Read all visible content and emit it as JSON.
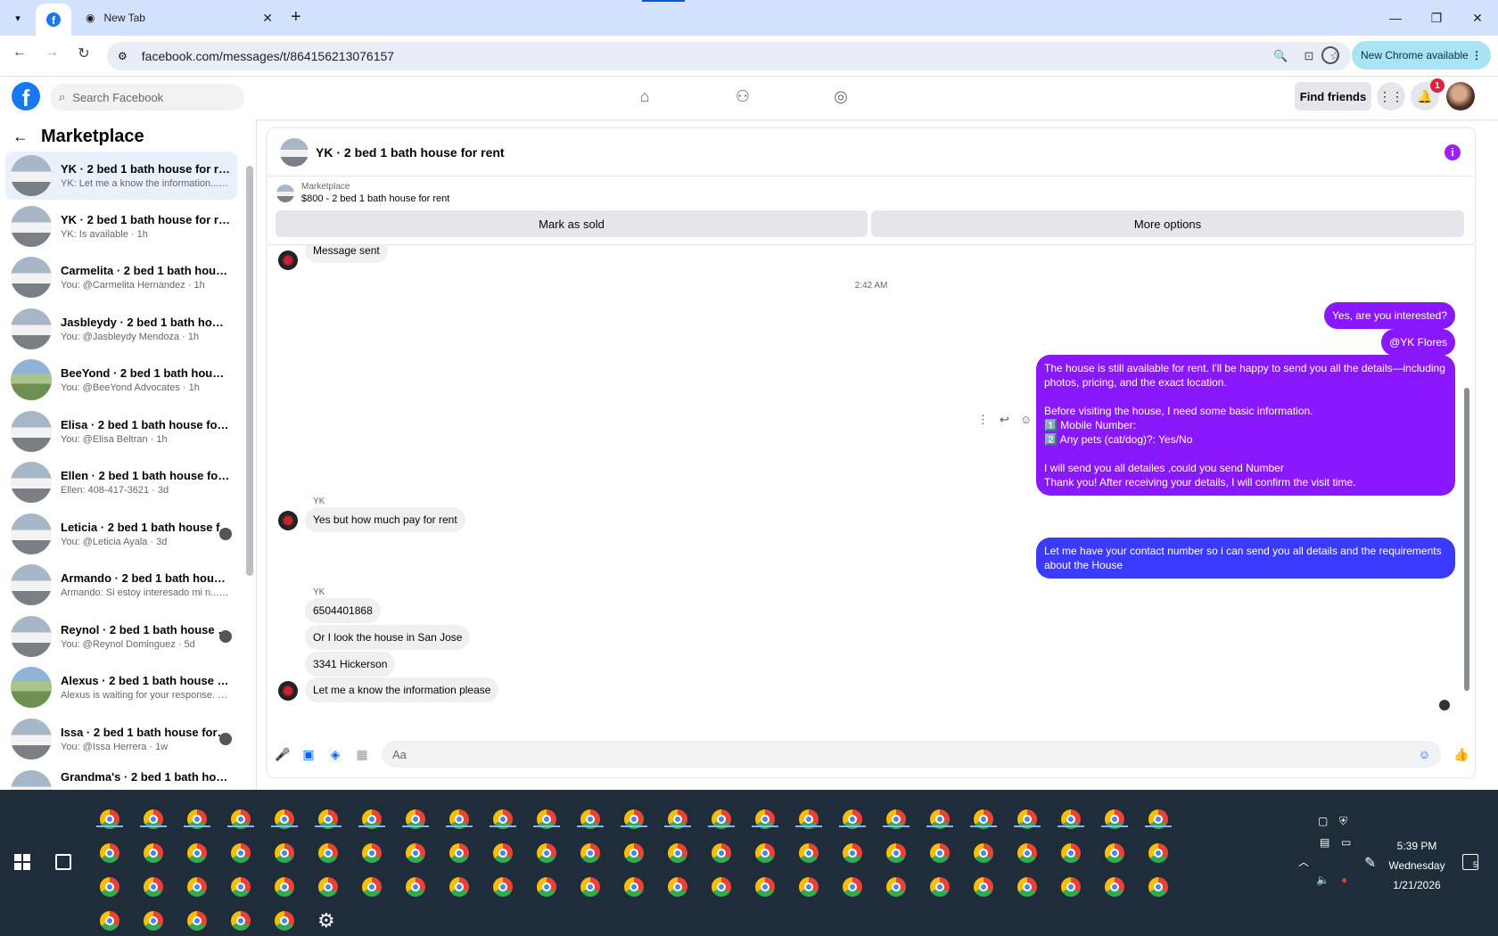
{
  "browser": {
    "tab_title": "New Tab",
    "url": "facebook.com/messages/t/864156213076157",
    "new_chrome": "New Chrome available"
  },
  "fb_header": {
    "search_placeholder": "Search Facebook",
    "find_friends": "Find friends",
    "notif_count": "1"
  },
  "sidebar": {
    "title": "Marketplace",
    "conversations": [
      {
        "name": "YK · 2 bed 1 bath house for rent",
        "sub": "YK: Let me a know the information... · 1h"
      },
      {
        "name": "YK · 2 bed 1 bath house for rent",
        "sub": "YK: Is available · 1h"
      },
      {
        "name": "Carmelita · 2 bed 1 bath house f...",
        "sub": "You: @Carmelita Hernandez · 1h"
      },
      {
        "name": "Jasbleydy · 2 bed 1 bath house f...",
        "sub": "You: @Jasbleydy Mendoza · 1h"
      },
      {
        "name": "BeeYond · 2 bed 1 bath house f...",
        "sub": "You: @BeeYond Advocates · 1h"
      },
      {
        "name": "Elisa · 2 bed 1 bath house for rent",
        "sub": "You: @Elisa Beltran · 1h"
      },
      {
        "name": "Ellen · 2 bed 1 bath house for rent",
        "sub": "Ellen: 408-417-3621 · 3d"
      },
      {
        "name": "Leticia · 2 bed 1 bath house f...",
        "sub": "You: @Leticia Ayala · 3d"
      },
      {
        "name": "Armando · 2 bed 1 bath house f...",
        "sub": "Armando: Si estoy interesado mi n... · 3d"
      },
      {
        "name": "Reynol · 2 bed 1 bath house f...",
        "sub": "You: @Reynol Dominguez · 5d"
      },
      {
        "name": "Alexus · 2 bed 1 bath house for ...",
        "sub": "Alexus is waiting for your response. · 1w"
      },
      {
        "name": "Issa · 2 bed 1 bath house for r...",
        "sub": "You: @Issa Herrera · 1w"
      },
      {
        "name": "Grandma's · 2 bed 1 bath house ...",
        "sub": ""
      }
    ]
  },
  "chat": {
    "title": "YK · 2 bed 1 bath house for rent",
    "listing_label": "Marketplace",
    "listing_title": "$800 - 2 bed 1 bath house for rent",
    "mark_sold": "Mark as sold",
    "more_options": "More options",
    "msg_sent": "Message sent",
    "timestamp": "2:42 AM",
    "out1": "Yes, are you interested?",
    "out2": "@YK Flores",
    "out3_l1": "The house is still available for rent. I'll be happy to send you all the details—including",
    "out3_l2": "photos, pricing, and the exact location.",
    "out3_l3": "Before visiting the house, I need some basic information.",
    "out3_l4": "1️⃣ Mobile Number:",
    "out3_l5": "2️⃣ Any pets (cat/dog)?: Yes/No",
    "out3_l6": "I will send you all detailes ,could you send Number",
    "out3_l7": "Thank you! After receiving your details, I will confirm the visit time.",
    "sender": "YK",
    "in1": "Yes but how much pay for rent",
    "out4_l1": "Let me have your contact number so i can send you all details and the requirements",
    "out4_l2": "about the House",
    "in2": "6504401868",
    "in3": "Or I look the house in San Jose",
    "in4": "3341 Hickerson",
    "in5": "Let me a know the information please",
    "composer_placeholder": "Aa"
  },
  "taskbar": {
    "time": "5:39 PM",
    "day": "Wednesday",
    "date": "1/21/2026",
    "notif_count": "5"
  }
}
